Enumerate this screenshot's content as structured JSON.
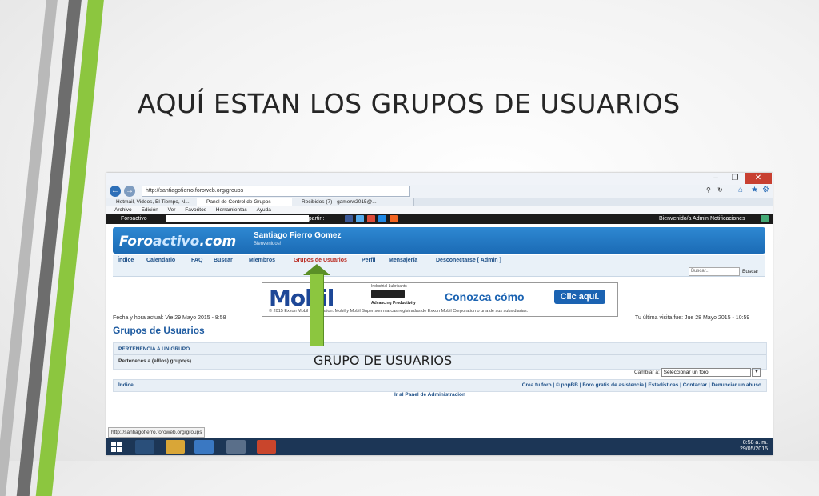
{
  "slide": {
    "title": "AQUÍ ESTAN LOS GRUPOS DE USUARIOS",
    "callout": "GRUPO DE USUARIOS"
  },
  "browser": {
    "url": "http://santiagofierro.foroweb.org/groups",
    "tabs": [
      {
        "label": "Hotmail, Videos, El Tiempo, N...",
        "active": false
      },
      {
        "label": "Panel de Control de Grupos",
        "active": true
      },
      {
        "label": "Recibidos (7) - gamerw2015@...",
        "active": false
      }
    ],
    "menu": [
      "Archivo",
      "Edición",
      "Ver",
      "Favoritos",
      "Herramientas",
      "Ayuda"
    ],
    "status_url": "http://santiagofierro.foroweb.org/groups"
  },
  "forum_bar": {
    "brand": "Foroactivo",
    "share_label": "Compartir :",
    "welcome": "Bienvenido/a Admin",
    "notifications": "Notificaciones"
  },
  "forum": {
    "logo_a": "Foro",
    "logo_b": "activo",
    "logo_c": ".com",
    "site_name": "Santiago Fierro Gomez",
    "site_sub": "Bienvenidos!",
    "nav": {
      "index": "Índice",
      "calendar": "Calendario",
      "faq": "FAQ",
      "search": "Buscar",
      "members": "Miembros",
      "groups": "Grupos de Usuarios",
      "profile": "Perfil",
      "messages": "Mensajería",
      "logout": "Desconectarse [ Admin ]"
    },
    "search_placeholder": "Buscar...",
    "search_button": "Buscar",
    "date_now": "Fecha y hora actual: Vie 29 Mayo 2015 - 8:58",
    "last_visit": "Tu última visita fue: Jue 28 Mayo 2015 - 10:59",
    "page_title": "Grupos de Usuarios",
    "membership_header": "PERTENENCIA A UN GRUPO",
    "membership_text": "Perteneces a (el/los) grupo(s).",
    "change_label": "Cambiar a:",
    "change_value": "Seleccionar un foro",
    "footer_index": "Índice",
    "footer_links": "Crea tu foro  |  © phpBB  |  Foro gratis de asistencia  |  Estadísticas  |  Contactar  |  Denunciar un abuso",
    "admin_panel": "Ir al Panel de Administración"
  },
  "ad": {
    "brand": "Mobil",
    "tag": "Industrial Lubricants",
    "adv": "Advancing Productivity",
    "cta_text": "Conozca cómo",
    "cta_button": "Clic aquí.",
    "fine": "© 2015 Exxon Mobil Corporation. Mobil y Mobil Super son marcas registradas de Exxon Mobil Corporation o una de sus subsidiarias."
  },
  "taskbar": {
    "time": "8:58 a. m.",
    "date": "29/05/2015"
  },
  "colors": {
    "accent_green": "#8cc63f",
    "forum_blue": "#1b6bb5",
    "taskbar": "#1c3656"
  }
}
